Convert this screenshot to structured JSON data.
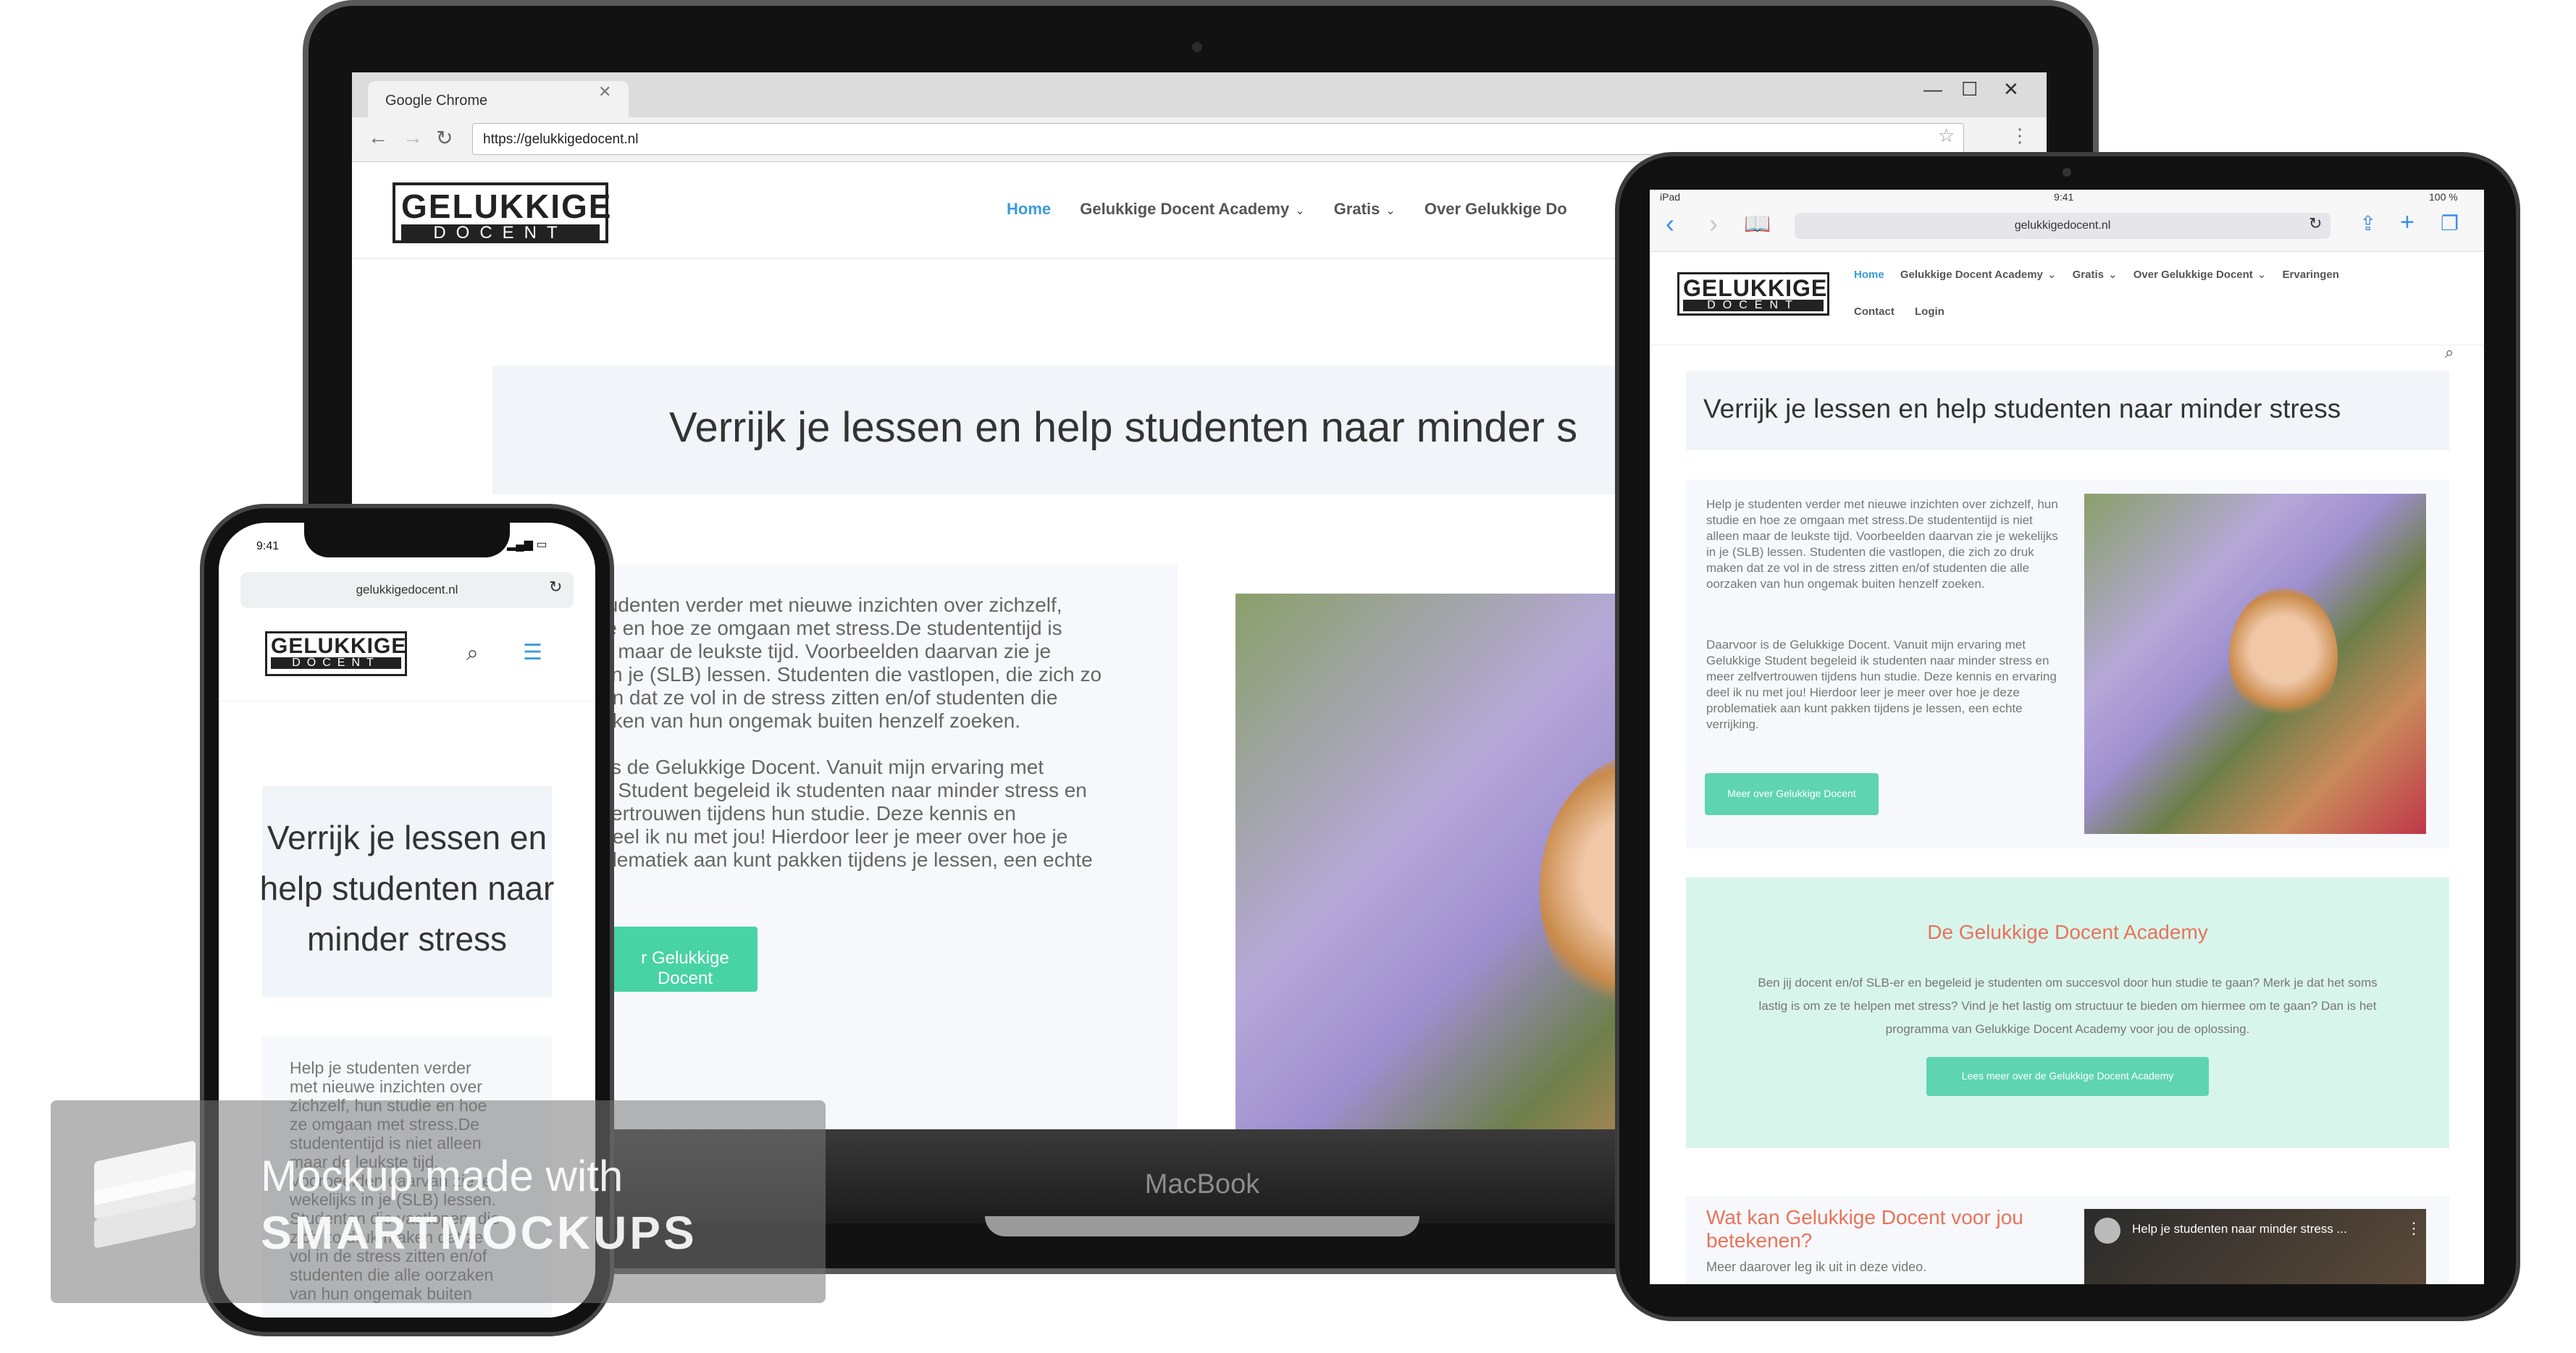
{
  "browser": {
    "tab_title": "Google Chrome",
    "url": "https://gelukkigedocent.nl"
  },
  "logo": {
    "line1": "GELUKKIGE",
    "line2": "DOCENT"
  },
  "nav": {
    "home": "Home",
    "academy": "Gelukkige Docent Academy",
    "gratis": "Gratis",
    "over": "Over Gelukkige Docent",
    "over_cut": "Over Gelukkige Do",
    "ervaringen": "Ervaringen",
    "contact": "Contact",
    "login": "Login"
  },
  "hero": {
    "title": "Verrijk je lessen en help studenten naar minder stress",
    "title_cut": "Verrijk je lessen en help studenten naar minder s"
  },
  "intro": {
    "p1": "Help je studenten verder met nieuwe inzichten over zichzelf, hun studie en hoe ze omgaan met stress.De studententijd is niet alleen maar de leukste tijd. Voorbeelden daarvan zie je wekelijks in je (SLB) lessen. Studenten die vastlopen, die zich zo druk maken dat ze vol in de stress zitten en/of studenten die alle oorzaken van hun ongemak buiten henzelf zoeken.",
    "p2": "Daarvoor is de Gelukkige Docent. Vanuit mijn ervaring met Gelukkige Student begeleid ik studenten naar minder stress en meer zelfvertrouwen tijdens hun studie. Deze kennis en ervaring deel ik nu met jou! Hierdoor leer je meer over hoe je deze problematiek aan kunt pakken tijdens je lessen, een echte verrijking.",
    "button": "Meer over Gelukkige Docent",
    "button_cut": "r Gelukkige Docent"
  },
  "mac_intro_lines": [
    "tudenten verder met nieuwe inzichten over zichzelf,",
    "ie en hoe ze omgaan met stress.De studententijd is",
    "n maar de leukste tijd. Voorbeelden daarvan zie je",
    " in je (SLB) lessen. Studenten die vastlopen, die zich zo",
    "en dat ze vol in de stress zitten en/of studenten die",
    "aken van hun ongemak buiten henzelf zoeken.",
    "",
    " is de Gelukkige Docent. Vanuit mijn ervaring met",
    "e Student begeleid ik studenten naar minder stress en",
    "vertrouwen tijdens hun studie. Deze kennis en",
    "deel ik nu met jou! Hierdoor leer je meer over hoe je",
    "blematiek aan kunt pakken tijdens je lessen, een echte",
    "."
  ],
  "phone_intro_lines": [
    "Help je studenten verder",
    "met nieuwe inzichten over",
    "zichzelf, hun studie en hoe",
    "ze omgaan met stress.De",
    "studententijd is niet alleen",
    "maar de leukste tijd.",
    "Voorbeelden daarvan zie je",
    "wekelijks in je (SLB) lessen.",
    "Studenten die vastlopen, die",
    "zich zo druk maken dat ze",
    "vol in de stress zitten en/of",
    "studenten die alle oorzaken",
    "van hun ongemak buiten"
  ],
  "academy": {
    "title": "De Gelukkige Docent Academy",
    "text": "Ben jij docent en/of SLB-er en begeleid je studenten om succesvol door hun studie te gaan? Merk je dat het soms lastig is om ze te helpen met stress? Vind je het lastig om structuur te bieden om hiermee om te gaan? Dan is het programma van Gelukkige Docent Academy voor jou de oplossing.",
    "button": "Lees meer over de Gelukkige Docent Academy"
  },
  "video": {
    "heading": "Wat kan Gelukkige Docent voor jou betekenen?",
    "sub": "Meer daarover leg ik uit in deze video.",
    "title": "Help je studenten naar minder stress ..."
  },
  "ipad_status": {
    "left": "iPad",
    "time": "9:41",
    "battery": "100 %"
  },
  "ipad_url": "gelukkigedocent.nl",
  "phone_status": {
    "time": "9:41"
  },
  "phone_url": "gelukkigedocent.nl",
  "mac_brand": "MacBook",
  "watermark": {
    "line1": "Mockup made with",
    "line2": "SMARTMOCKUPS"
  },
  "colors": {
    "link": "#3a9ad9",
    "teal": "#5fd4b1",
    "coral": "#e8735a",
    "mint_bg": "#d8f5ec"
  }
}
